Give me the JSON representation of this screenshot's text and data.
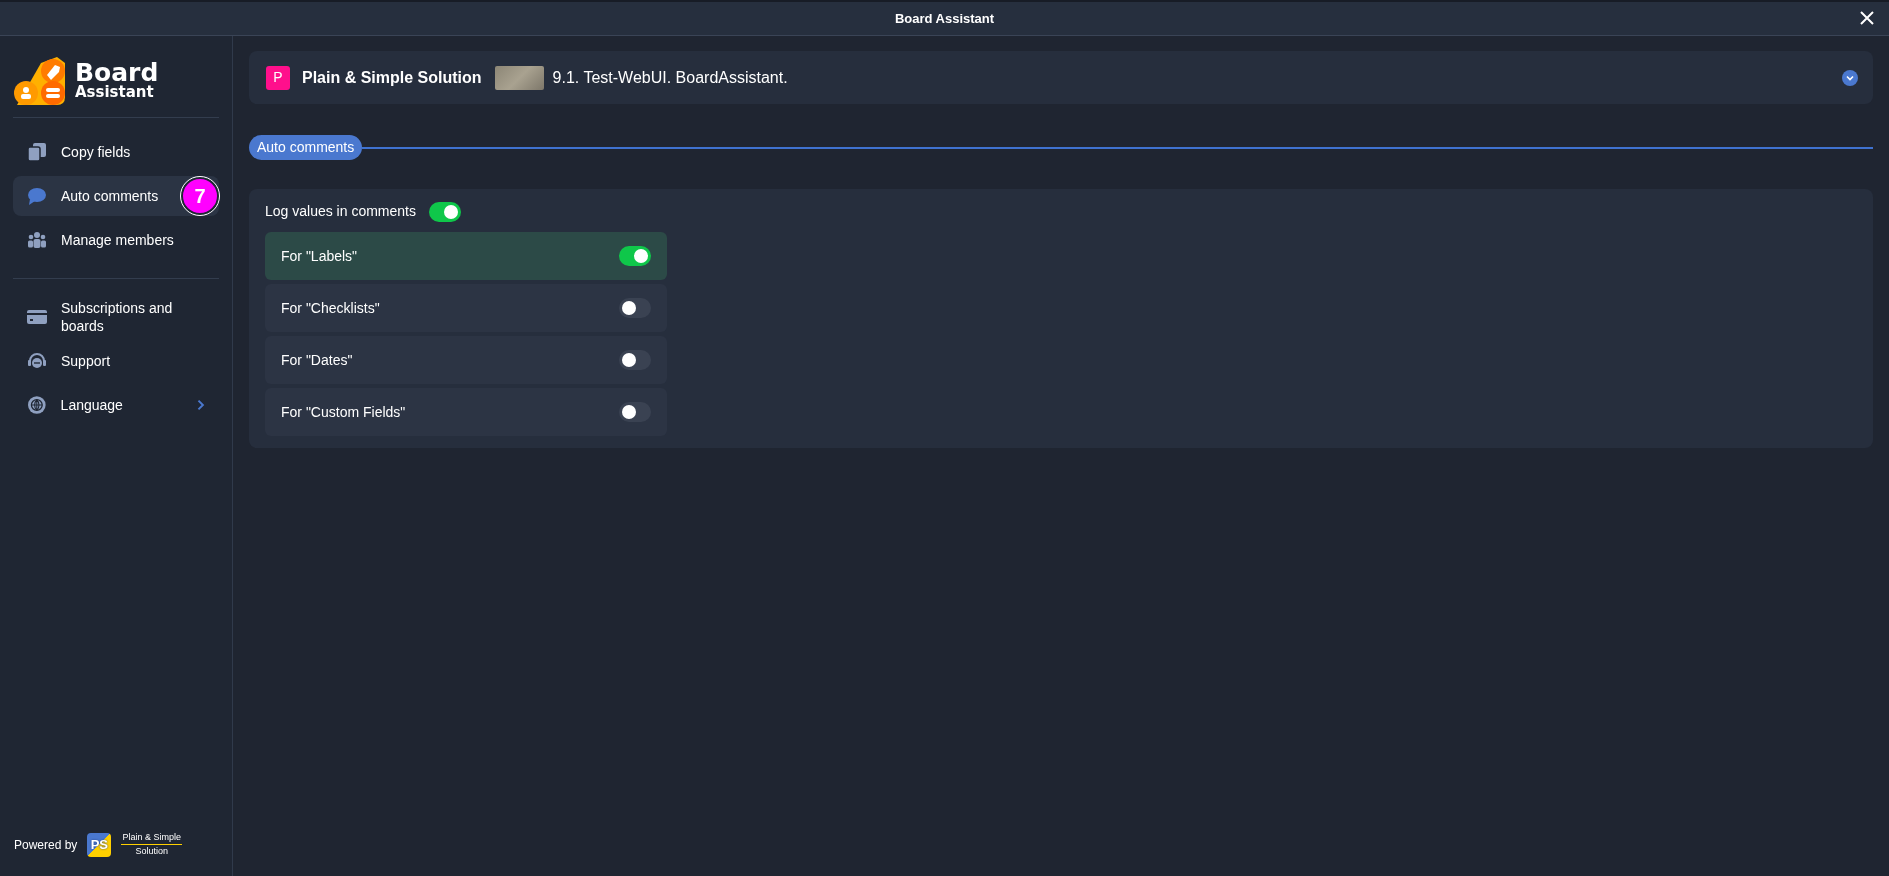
{
  "window": {
    "title": "Board Assistant"
  },
  "logo": {
    "line_1": "Board",
    "line_2": "Assistant"
  },
  "sidebar": {
    "items": [
      {
        "kind": "copy",
        "label": "Copy fields",
        "selected": false
      },
      {
        "kind": "comment",
        "label": "Auto comments",
        "selected": true,
        "badge": "7"
      },
      {
        "kind": "members",
        "label": "Manage members",
        "selected": false
      }
    ],
    "secondary_items": [
      {
        "kind": "card",
        "label": "Subscriptions and boards",
        "submenu": false
      },
      {
        "kind": "support",
        "label": "Support",
        "submenu": false
      },
      {
        "kind": "globe",
        "label": "Language",
        "submenu": true
      }
    ],
    "footer": {
      "powered_by": "Powered by",
      "logo_letters": "PS",
      "company_line_1": "Plain & Simple",
      "company_line_2": "Solution"
    }
  },
  "board_header": {
    "workspace_initial": "P",
    "workspace_name": "Plain & Simple Solution",
    "board_name": "9.1. Test-WebUI. BoardAssistant."
  },
  "section": {
    "title": "Auto comments"
  },
  "master_setting": {
    "label": "Log values in comments",
    "on": true
  },
  "settings": [
    {
      "label": "For \"Labels\"",
      "on": true
    },
    {
      "label": "For \"Checklists\"",
      "on": false
    },
    {
      "label": "For \"Dates\"",
      "on": false
    },
    {
      "label": "For \"Custom Fields\"",
      "on": false
    }
  ]
}
